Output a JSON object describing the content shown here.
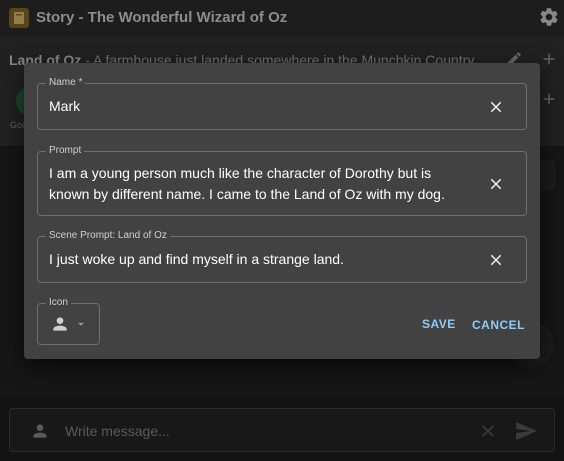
{
  "app": {
    "title": "Story - The Wonderful Wizard of Oz",
    "logo_icon": "book-icon",
    "settings_icon": "gear-icon"
  },
  "scene": {
    "name": "Land of Oz",
    "separator": " - ",
    "description": "A farmhouse just landed somewhere in the Munchkin Country",
    "character_label": "Goo"
  },
  "dialog": {
    "name_field": {
      "label": "Name *",
      "value": "Mark"
    },
    "prompt_field": {
      "label": "Prompt",
      "value_line1": "I am a young person much like the character of Dorothy but is",
      "value_line2": "known by different name. I came to the Land of Oz with my dog."
    },
    "scene_prompt_field": {
      "label": "Scene Prompt: Land of Oz",
      "value": "I just woke up and find myself in a strange land."
    },
    "icon_field": {
      "label": "Icon",
      "value_icon": "person-icon"
    },
    "save_label": "SAVE",
    "cancel_label": "CANCEL"
  },
  "composer": {
    "placeholder": "Write message..."
  },
  "colors": {
    "accent": "#90caf9",
    "dialog_bg": "#424242",
    "page_bg": "#1c1c1c"
  }
}
